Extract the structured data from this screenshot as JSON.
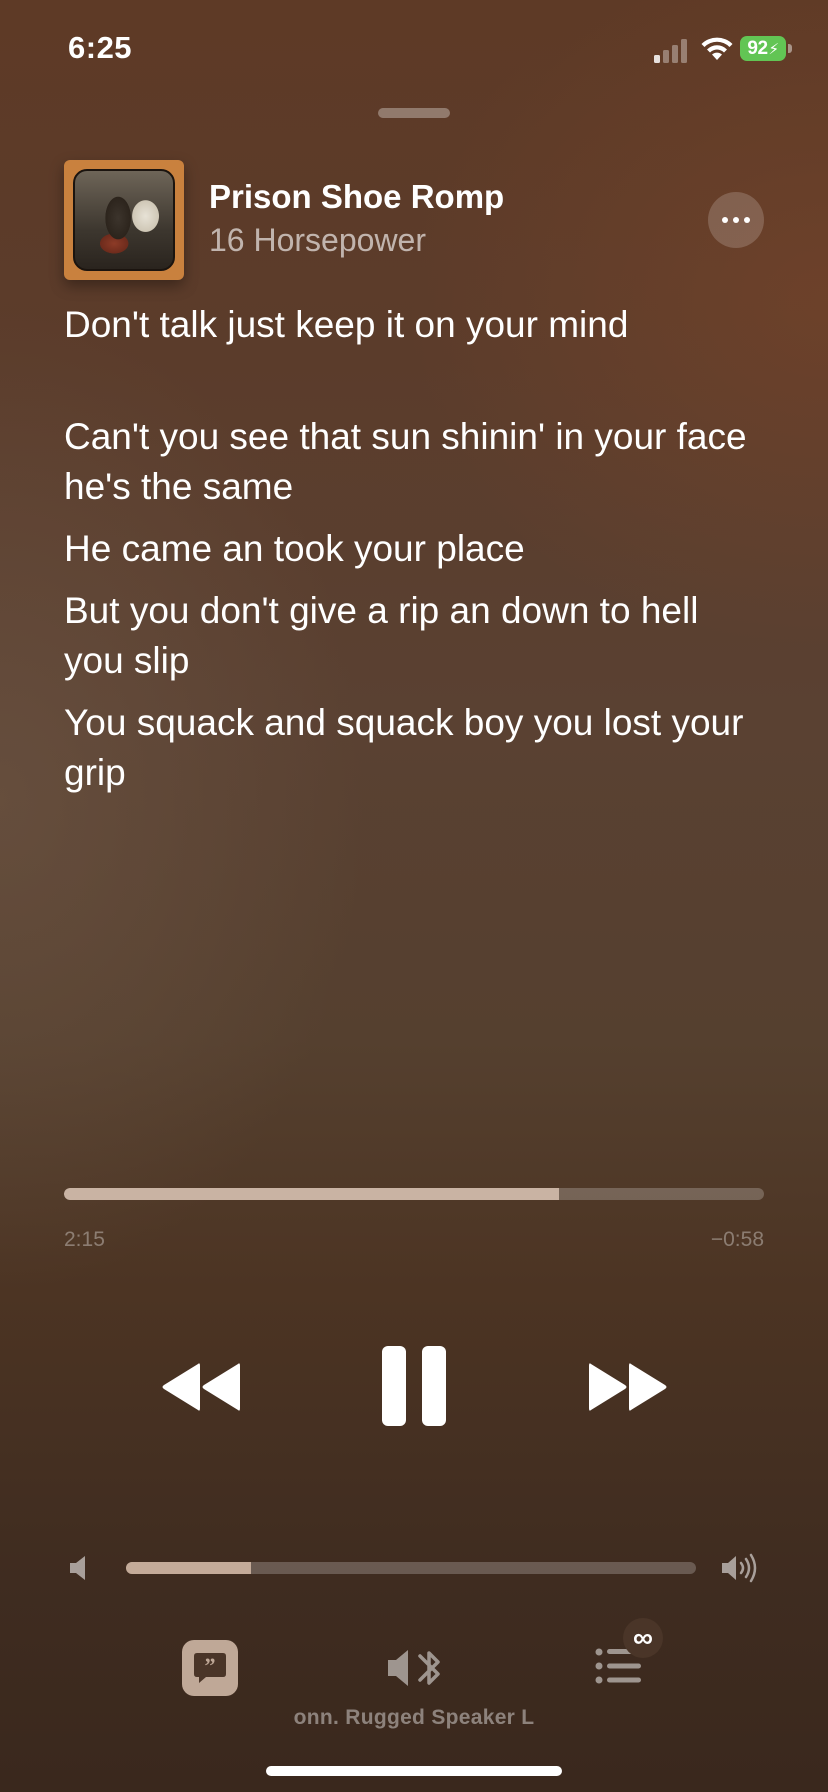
{
  "status_bar": {
    "time": "6:25",
    "battery_level": "92",
    "battery_color": "#62c554",
    "icons": [
      "signal-icon",
      "wifi-icon",
      "battery-charging-icon"
    ]
  },
  "now_playing": {
    "title": "Prison Shoe Romp",
    "artist": "16 Horsepower",
    "more_icon": "ellipsis-icon"
  },
  "lyrics": [
    "Don't talk just keep it on your mind",
    "Can't you see that sun shinin' in your face he's the same",
    "He came an took your place",
    "But you don't give a rip an down to hell you slip",
    "You squack and squack boy you lost your grip"
  ],
  "progress": {
    "elapsed": "2:15",
    "remaining": "−0:58",
    "fraction": 0.707
  },
  "controls": {
    "rewind_icon": "backward-icon",
    "pause_icon": "pause-icon",
    "forward_icon": "forward-icon"
  },
  "volume": {
    "fraction": 0.22,
    "low_icon": "speaker-low-icon",
    "high_icon": "speaker-high-icon"
  },
  "bottom_bar": {
    "lyrics_icon": "lyrics-quote-icon",
    "airplay_icon": "bluetooth-speaker-icon",
    "queue_icon": "queue-list-icon",
    "queue_badge": "∞",
    "output_device": "onn. Rugged Speaker L"
  },
  "colors": {
    "background_top": "#5e3a26",
    "background_bottom": "#3a281d",
    "progress_fill": "#c9b3a3"
  }
}
